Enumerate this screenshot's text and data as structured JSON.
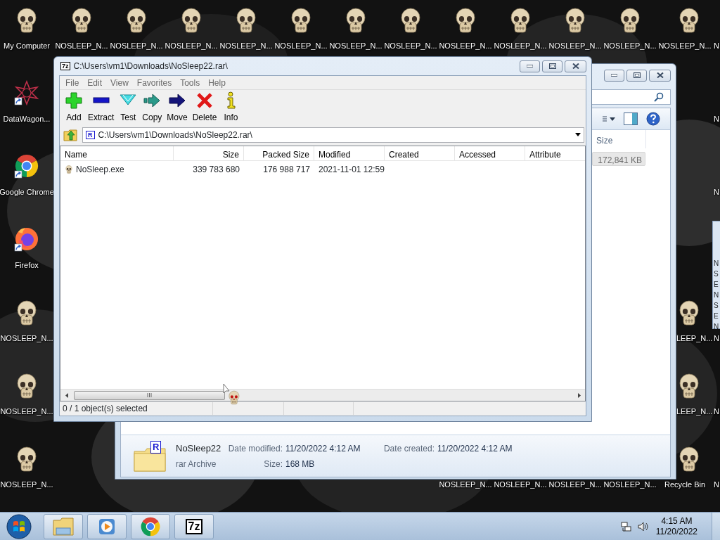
{
  "desktop": {
    "icons": [
      {
        "label": "My Computer",
        "kind": "skull"
      },
      {
        "label": "NOSLEEP_N...",
        "kind": "skull"
      },
      {
        "label": "NOSLEEP_N...",
        "kind": "skull"
      },
      {
        "label": "NOSLEEP_N...",
        "kind": "skull"
      },
      {
        "label": "NOSLEEP_N...",
        "kind": "skull"
      },
      {
        "label": "NOSLEEP_N...",
        "kind": "skull"
      },
      {
        "label": "NOSLEEP_N...",
        "kind": "skull"
      },
      {
        "label": "NOSLEEP_N...",
        "kind": "skull"
      },
      {
        "label": "NOSLEEP_N...",
        "kind": "skull"
      },
      {
        "label": "NOSLEEP_N...",
        "kind": "skull"
      },
      {
        "label": "NOSLEEP_N...",
        "kind": "skull"
      },
      {
        "label": "NOSLEEP_N...",
        "kind": "skull"
      },
      {
        "label": "NOSLEEP_N...",
        "kind": "skull"
      },
      {
        "label": "N",
        "kind": "label"
      },
      {
        "label": "DataWagon...",
        "kind": "star_shortcut"
      },
      {
        "label": "N",
        "kind": "label"
      },
      {
        "label": "Google Chrome",
        "kind": "chrome_shortcut"
      },
      {
        "label": "N",
        "kind": "label"
      },
      {
        "label": "Firefox",
        "kind": "firefox_shortcut"
      },
      {
        "label": "NOSLEEP_N...",
        "kind": "skull"
      },
      {
        "label": "LEEP_N...",
        "kind": "skull"
      },
      {
        "label": "N",
        "kind": "label"
      },
      {
        "label": "NOSLEEP_N...",
        "kind": "skull"
      },
      {
        "label": "LEEP_N...",
        "kind": "skull"
      },
      {
        "label": "N",
        "kind": "label"
      },
      {
        "label": "NOSLEEP_N...",
        "kind": "skull"
      },
      {
        "label": "NOSLEEP_N...",
        "kind": "label"
      },
      {
        "label": "NOSLEEP_N...",
        "kind": "label"
      },
      {
        "label": "NOSLEEP_N...",
        "kind": "label"
      },
      {
        "label": "NOSLEEP_N...",
        "kind": "label"
      },
      {
        "label": "Recycle Bin",
        "kind": "skull"
      },
      {
        "label": "N",
        "kind": "label"
      }
    ]
  },
  "side_panel": {
    "lines": [
      "N",
      "S",
      "E",
      "N",
      "S",
      "E",
      "N"
    ]
  },
  "explorer_window": {
    "column_header": "Size",
    "size_cell": "172,841 KB",
    "details": {
      "icon_text": "R",
      "name": "NoSleep22",
      "type": "rar Archive",
      "date_modified_label": "Date modified:",
      "date_modified": "11/20/2022 4:12 AM",
      "size_label": "Size:",
      "size": "168 MB",
      "date_created_label": "Date created:",
      "date_created": "11/20/2022 4:12 AM"
    }
  },
  "archive_window": {
    "icon_text": "7z",
    "title": "C:\\Users\\vm1\\Downloads\\NoSleep22.rar\\",
    "menu": [
      "File",
      "Edit",
      "View",
      "Favorites",
      "Tools",
      "Help"
    ],
    "toolbar": [
      {
        "label": "Add",
        "kind": "add"
      },
      {
        "label": "Extract",
        "kind": "extract"
      },
      {
        "label": "Test",
        "kind": "test"
      },
      {
        "label": "Copy",
        "kind": "copy"
      },
      {
        "label": "Move",
        "kind": "move"
      },
      {
        "label": "Delete",
        "kind": "delete"
      },
      {
        "label": "Info",
        "kind": "info"
      }
    ],
    "address_icon_text": "R",
    "address": "C:\\Users\\vm1\\Downloads\\NoSleep22.rar\\",
    "columns": [
      "Name",
      "Size",
      "Packed Size",
      "Modified",
      "Created",
      "Accessed",
      "Attribute"
    ],
    "rows": [
      {
        "name": "NoSleep.exe",
        "size": "339 783 680",
        "packed_size": "176 988 717",
        "modified": "2021-11-01 12:59"
      }
    ],
    "status": "0 / 1 object(s) selected"
  },
  "taskbar": {
    "buttons": [
      {
        "kind": "explorer"
      },
      {
        "kind": "media_player"
      },
      {
        "kind": "chrome"
      },
      {
        "kind": "sevenzip",
        "label": "7z"
      }
    ],
    "time": "4:15 AM",
    "date": "11/20/2022"
  }
}
